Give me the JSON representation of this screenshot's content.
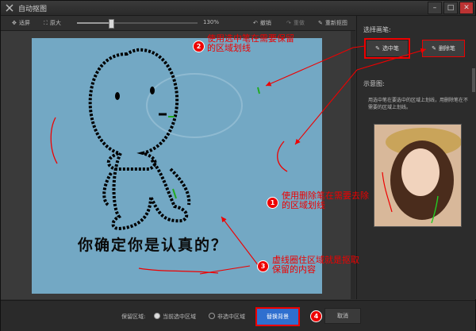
{
  "window": {
    "title": "自动抠图",
    "min_icon": "minimize-icon",
    "max_icon": "maximize-icon",
    "close_icon": "close-icon"
  },
  "toolbar": {
    "fit_label": "适屏",
    "original_label": "原大",
    "zoom_value": "130%",
    "zoom_fraction": 0.28,
    "undo_label": "撤销",
    "redo_label": "重做",
    "redraw_label": "重新抠图"
  },
  "panel": {
    "brush_label": "选择画笔:",
    "select_pen_label": "选中笔",
    "delete_pen_label": "删除笔",
    "sample_label": "示意图:",
    "tip_text": "用选中笔在要选中的区域上划线，用删除笔在不需要的区域上划线。"
  },
  "canvas": {
    "image_text": "你确定你是认真的？"
  },
  "bottom": {
    "keep_label": "保留区域:",
    "keep_selected": "当前选中区域",
    "keep_unselected": "非选中区域",
    "replace_bg": "替换背景",
    "cancel": "取消"
  },
  "annotations": {
    "a1_num": "1",
    "a1_text_line1": "使用删除笔在需要去除",
    "a1_text_line2": "的区域划线",
    "a2_num": "2",
    "a2_text_line1": "使用选中笔在需要保留",
    "a2_text_line2": "的区域划线",
    "a3_num": "3",
    "a3_text_line1": "虚线圈住区域就是抠取",
    "a3_text_line2": "保留的内容",
    "a4_num": "4"
  },
  "colors": {
    "annotation": "#ee0000",
    "canvas_bg": "#73a8c4",
    "primary_button": "#2f6fcf"
  }
}
